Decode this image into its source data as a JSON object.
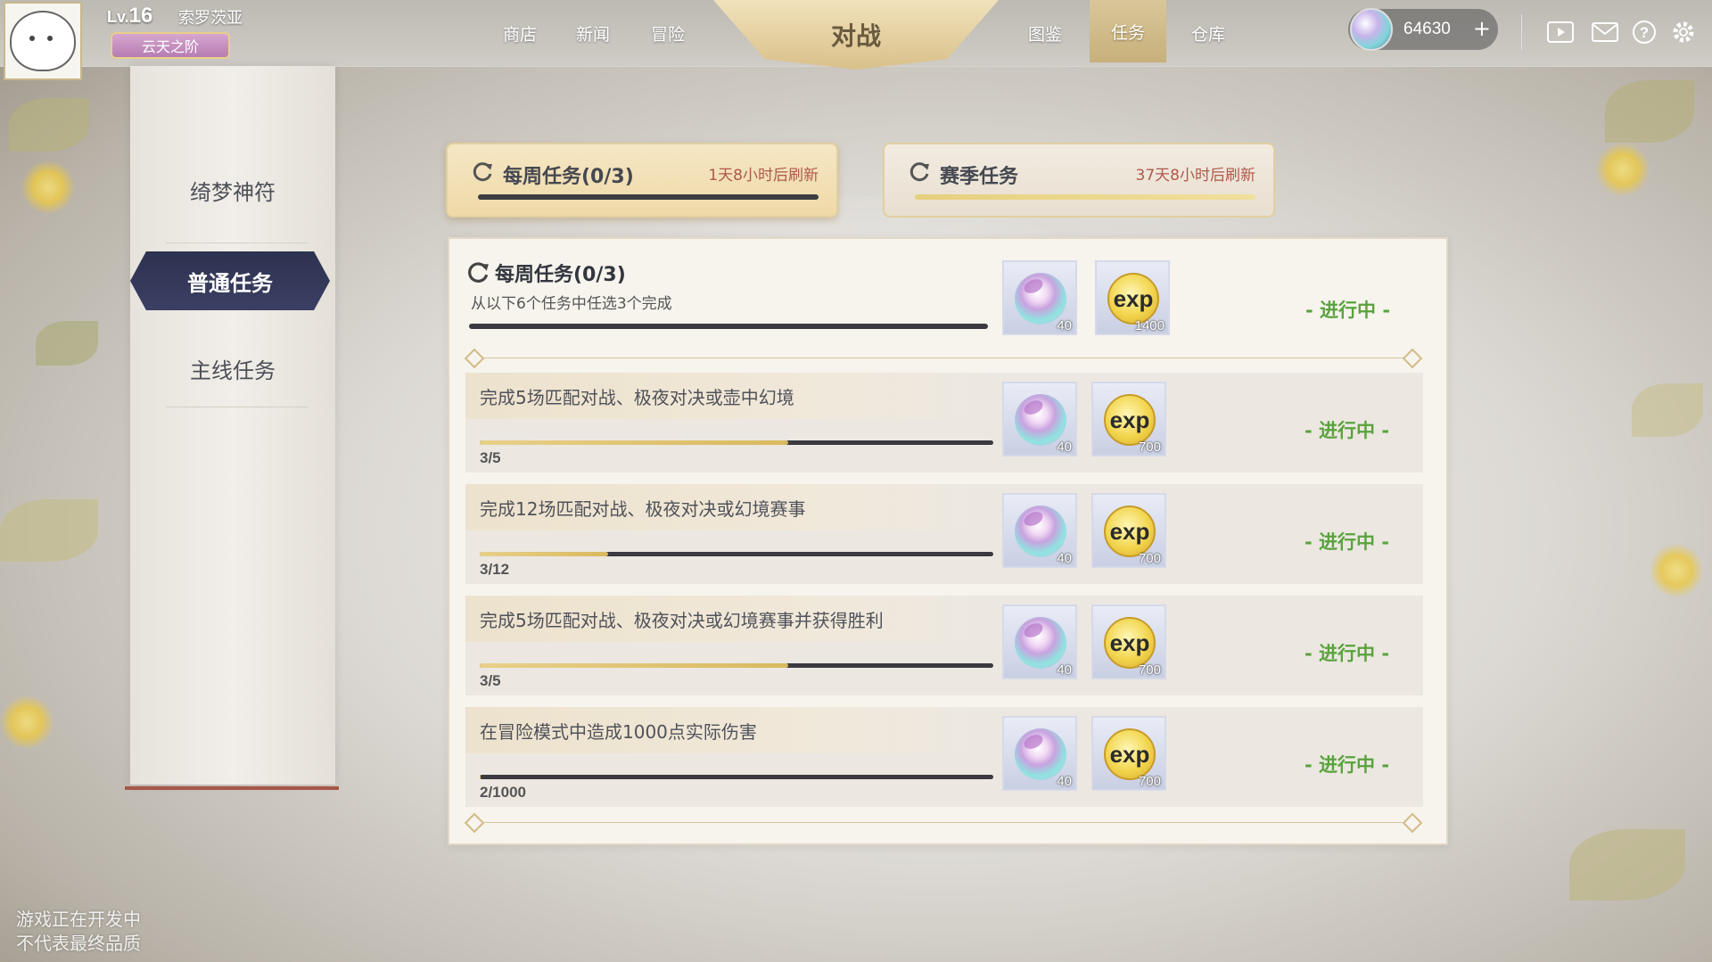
{
  "player": {
    "level_prefix": "Lv.",
    "level": "16",
    "name": "索罗茨亚",
    "rank": "云天之阶"
  },
  "nav": {
    "items": [
      "商店",
      "新闻",
      "冒险"
    ],
    "center": "对战",
    "right_items": [
      "图鉴",
      "任务",
      "仓库"
    ]
  },
  "currency": {
    "value": "64630",
    "plus": "+"
  },
  "sidebar": {
    "items": [
      "绮梦神符",
      "普通任务",
      "主线任务"
    ],
    "active": "普通任务"
  },
  "tabs": [
    {
      "name": "每周任务(0/3)",
      "refresh": "1天8小时后刷新"
    },
    {
      "name": "赛季任务",
      "refresh": "37天8小时后刷新"
    }
  ],
  "weekly": {
    "title": "每周任务(0/3)",
    "subtitle": "从以下6个任务中任选3个完成",
    "rewards": [
      "40",
      "1400"
    ],
    "status": "- 进行中 -"
  },
  "tasks": [
    {
      "name": "完成5场匹配对战、极夜对决或壶中幻境",
      "progress": "3/5",
      "fraction": 0.6,
      "rewards": [
        "40",
        "700"
      ],
      "status": "- 进行中 -"
    },
    {
      "name": "完成12场匹配对战、极夜对决或幻境赛事",
      "progress": "3/12",
      "fraction": 0.25,
      "rewards": [
        "40",
        "700"
      ],
      "status": "- 进行中 -"
    },
    {
      "name": "完成5场匹配对战、极夜对决或幻境赛事并获得胜利",
      "progress": "3/5",
      "fraction": 0.6,
      "rewards": [
        "40",
        "700"
      ],
      "status": "- 进行中 -"
    },
    {
      "name": "在冒险模式中造成1000点实际伤害",
      "progress": "2/1000",
      "fraction": 0.002,
      "rewards": [
        "40",
        "700"
      ],
      "status": "- 进行中 -"
    }
  ],
  "exp_label": "exp",
  "watermark": {
    "line1": "游戏正在开发中",
    "line2": "不代表最终品质"
  },
  "colors": {
    "accent_gold": "#e2cfa0",
    "status_green": "#5aa23f",
    "active_side": "#2d3250",
    "refresh_red": "#b0584a"
  }
}
